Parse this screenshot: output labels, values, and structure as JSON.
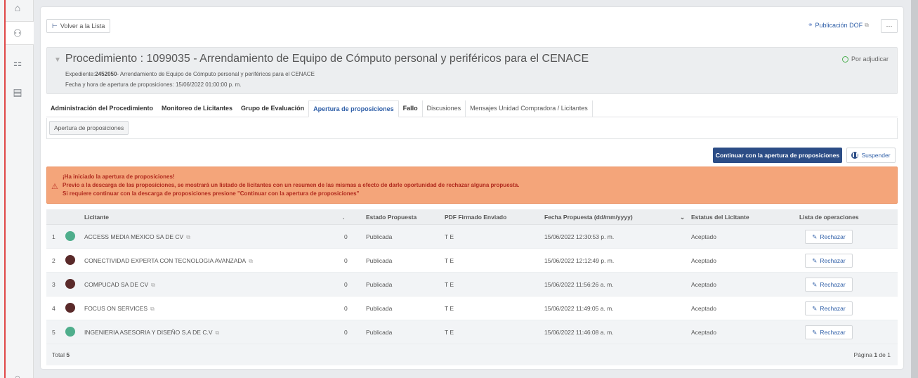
{
  "toolbar": {
    "back_label": "Volver a la Lista",
    "dof_label": "Publicación DOF",
    "more_label": "···"
  },
  "procedure": {
    "title": "Procedimiento : 1099035 - Arrendamiento de Equipo de Cómputo personal y periféricos para el CENACE",
    "expediente_label": "Expediente:",
    "expediente_number": "2452050",
    "expediente_desc": "- Arrendamiento de Equipo de Cómputo personal y periféricos para el CENACE",
    "apertura": "Fecha y hora de apertura de proposiciones: 15/06/2022 01:00:00 p. m.",
    "status": "Por adjudicar"
  },
  "tabs": [
    {
      "label": "Administración del Procedimiento"
    },
    {
      "label": "Monitoreo de Licitantes"
    },
    {
      "label": "Grupo de Evaluación"
    },
    {
      "label": "Apertura de proposiciones"
    },
    {
      "label": "Fallo"
    },
    {
      "label": "Discusiones"
    },
    {
      "label": "Mensajes Unidad Compradora / Licitantes"
    }
  ],
  "subtab_label": "Apertura de proposiciones",
  "actions": {
    "continue_label": "Continuar con la apertura de proposiciones",
    "suspend_label": "Suspender"
  },
  "alert": {
    "line1": "¡Ha iniciado la apertura de proposiciones!",
    "line2": "Previo a la descarga de las proposiciones, se mostrará un listado de licitantes con un resumen de las mismas a efecto de darle oportunidad de rechazar alguna propuesta.",
    "line3": "Si requiere continuar con la descarga de proposiciones presione \"Continuar con la apertura de proposiciones\""
  },
  "table": {
    "headers": {
      "licitante": "Licitante",
      "dot": ".",
      "estado": "Estado Propuesta",
      "pdf": "PDF Firmado Enviado",
      "fecha": "Fecha Propuesta (dd/mm/yyyy)",
      "sort": "⌄",
      "estatus": "Estatus del Licitante",
      "ops": "Lista de operaciones"
    },
    "rows": [
      {
        "num": "1",
        "name": "ACCESS MEDIA MEXICO SA DE CV",
        "count": "0",
        "estado": "Publicada",
        "pdf": "T E",
        "fecha": "15/06/2022 12:30:53 p. m.",
        "estatus": "Aceptado",
        "action": "Rechazar",
        "avatar_color": "#4fae8c"
      },
      {
        "num": "2",
        "name": "CONECTIVIDAD EXPERTA CON TECNOLOGIA AVANZADA",
        "count": "0",
        "estado": "Publicada",
        "pdf": "T E",
        "fecha": "15/06/2022 12:12:49 p. m.",
        "estatus": "Aceptado",
        "action": "Rechazar",
        "avatar_color": "#5a2a2a"
      },
      {
        "num": "3",
        "name": "COMPUCAD SA DE CV",
        "count": "0",
        "estado": "Publicada",
        "pdf": "T E",
        "fecha": "15/06/2022 11:56:26 a. m.",
        "estatus": "Aceptado",
        "action": "Rechazar",
        "avatar_color": "#5a2a2a"
      },
      {
        "num": "4",
        "name": "FOCUS ON SERVICES",
        "count": "0",
        "estado": "Publicada",
        "pdf": "T E",
        "fecha": "15/06/2022 11:49:05 a. m.",
        "estatus": "Aceptado",
        "action": "Rechazar",
        "avatar_color": "#5a2a2a"
      },
      {
        "num": "5",
        "name": "INGENIERIA ASESORIA Y DISEÑO S.A DE C.V",
        "count": "0",
        "estado": "Publicada",
        "pdf": "T E",
        "fecha": "15/06/2022 11:46:08 a. m.",
        "estatus": "Aceptado",
        "action": "Rechazar",
        "avatar_color": "#4fae8c"
      }
    ],
    "footer": {
      "total_label": "Total",
      "total": "5",
      "page_label": "Página",
      "page": "1",
      "of_label": "de",
      "pages": "1"
    }
  },
  "colors": {
    "primary": "#2c4d86",
    "alert_bg": "#f4a57a",
    "alert_text": "#b02a1e",
    "status_green": "#4caf50"
  }
}
